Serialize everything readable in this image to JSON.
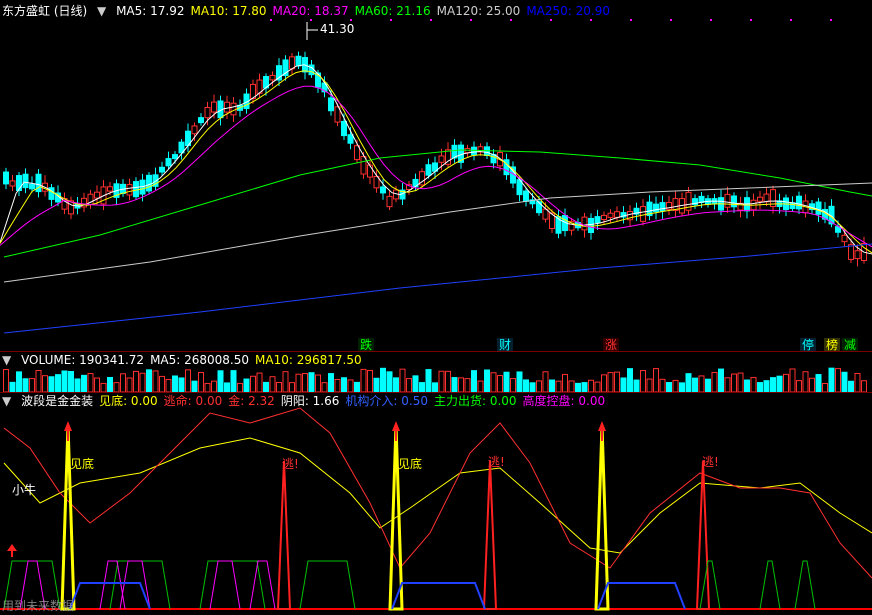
{
  "main": {
    "title": "东方盛虹 (日线)",
    "ma_items": [
      {
        "label": "MA5: 17.92",
        "color": "#ffffff"
      },
      {
        "label": "MA10: 17.80",
        "color": "#ffff00"
      },
      {
        "label": "MA20: 18.37",
        "color": "#ff00ff"
      },
      {
        "label": "MA60: 21.16",
        "color": "#00ff00"
      },
      {
        "label": "MA120: 25.00",
        "color": "#cccccc"
      },
      {
        "label": "MA250: 20.90",
        "color": "#0000ff"
      }
    ],
    "high_label": "41.30",
    "badges": [
      {
        "text": "跌",
        "color": "#00ff00"
      },
      {
        "text": "财",
        "color": "#00ffff"
      },
      {
        "text": "涨",
        "color": "#ff3030"
      },
      {
        "text": "停",
        "color": "#00ffff"
      },
      {
        "text": "榜",
        "color": "#ffff00"
      },
      {
        "text": "减",
        "color": "#00ff00"
      }
    ]
  },
  "volume": {
    "items": [
      {
        "label": "VOLUME: 190341.72",
        "color": "#ffffff"
      },
      {
        "label": "MA5: 268008.50",
        "color": "#ffffff"
      },
      {
        "label": "MA10: 296817.50",
        "color": "#ffff00"
      }
    ]
  },
  "indicator": {
    "items": [
      {
        "label": "波段是金金装",
        "color": "#ffffff"
      },
      {
        "label": "见底: 0.00",
        "color": "#ffff00"
      },
      {
        "label": "逃命: 0.00",
        "color": "#ff3030"
      },
      {
        "label": "金: 2.32",
        "color": "#ff3030"
      },
      {
        "label": "阴阳: 1.66",
        "color": "#ffffff"
      },
      {
        "label": "机构介入: 0.50",
        "color": "#3060ff"
      },
      {
        "label": "主力出货: 0.00",
        "color": "#00ff00"
      },
      {
        "label": "高度控盘: 0.00",
        "color": "#ff00ff"
      }
    ],
    "annotations": {
      "jiandi": "见底",
      "taoming": "逃!",
      "xiaoniu": "小牛"
    },
    "watermark": "用到未来数据"
  },
  "colors": {
    "up": "#ff3030",
    "down": "#00ffff",
    "separator": "#7a0000"
  }
}
